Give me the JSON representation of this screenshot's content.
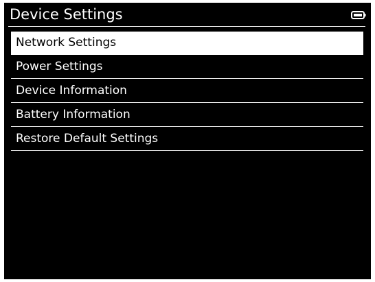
{
  "title_bar": {
    "title": "Device Settings",
    "battery_icon": "battery-icon"
  },
  "menu": {
    "selected_index": 0,
    "items": [
      {
        "label": "Network Settings"
      },
      {
        "label": "Power Settings"
      },
      {
        "label": "Device Information"
      },
      {
        "label": "Battery Information"
      },
      {
        "label": "Restore Default Settings"
      }
    ]
  },
  "colors": {
    "background": "#000000",
    "foreground": "#ffffff",
    "selected_background": "#ffffff",
    "selected_text": "#000000"
  }
}
